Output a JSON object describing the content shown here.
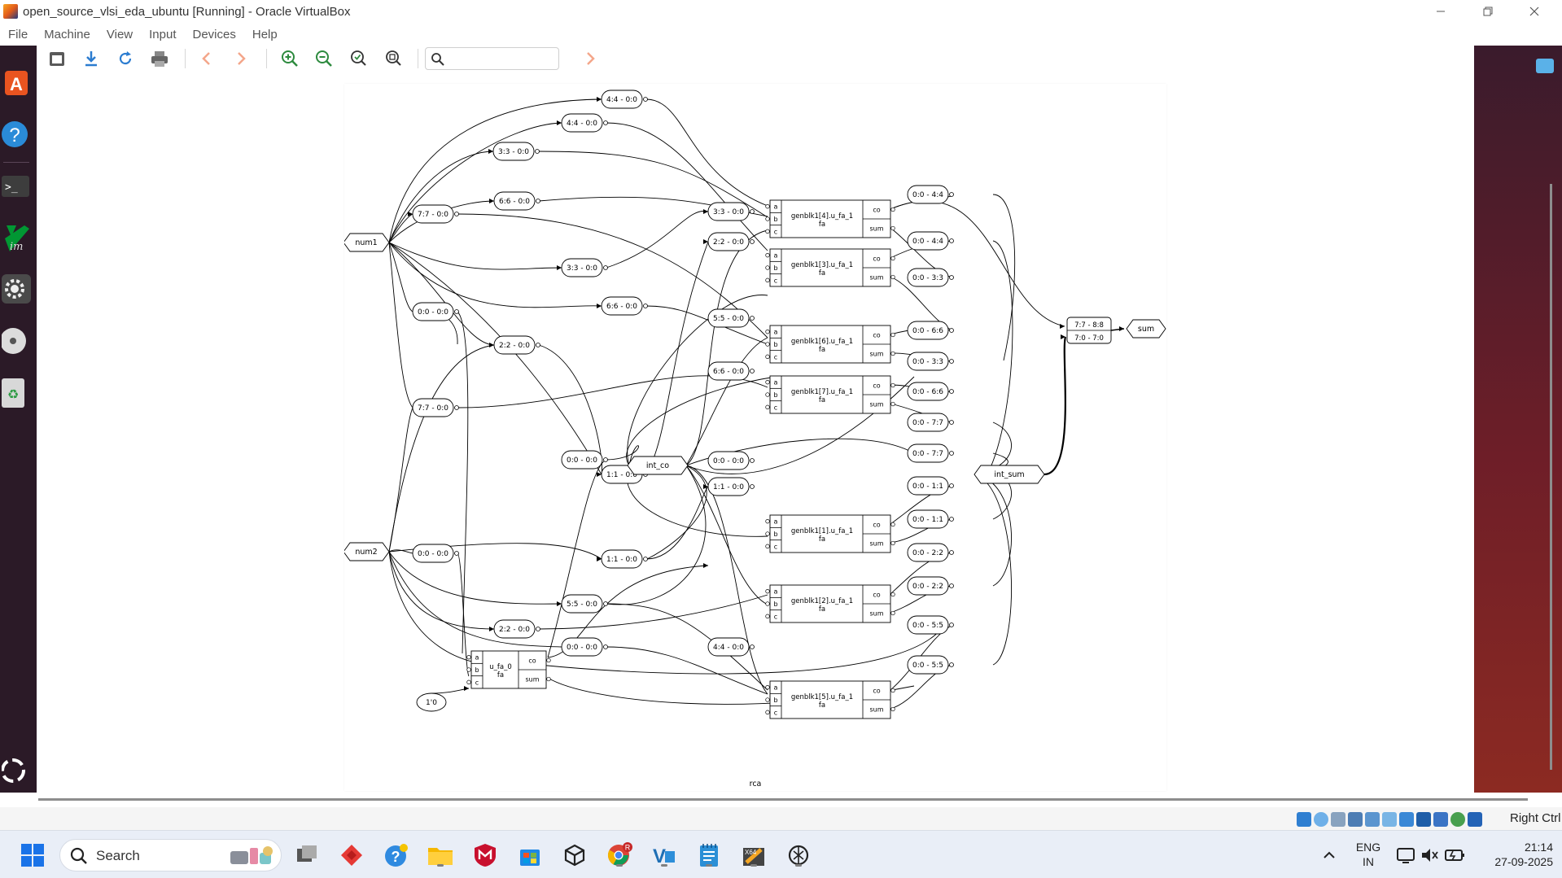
{
  "window": {
    "title": "open_source_vlsi_eda_ubuntu [Running] - Oracle VirtualBox",
    "minimize_icon": "minimize-icon",
    "maximize_icon": "restore-icon",
    "close_icon": "close-icon"
  },
  "menu": {
    "items": [
      "File",
      "Machine",
      "View",
      "Input",
      "Devices",
      "Help"
    ]
  },
  "viewer": {
    "search_value": ""
  },
  "graph": {
    "module_label": "rca",
    "ports": [
      "num1",
      "num2",
      "int_co",
      "int_sum",
      "sum"
    ],
    "cells": [
      {
        "name": "genblk1[4].u_fa_1",
        "type": "fa"
      },
      {
        "name": "genblk1[3].u_fa_1",
        "type": "fa"
      },
      {
        "name": "genblk1[6].u_fa_1",
        "type": "fa"
      },
      {
        "name": "genblk1[7].u_fa_1",
        "type": "fa"
      },
      {
        "name": "genblk1[1].u_fa_1",
        "type": "fa"
      },
      {
        "name": "genblk1[2].u_fa_1",
        "type": "fa"
      },
      {
        "name": "genblk1[5].u_fa_1",
        "type": "fa"
      },
      {
        "name": "u_fa_0",
        "type": "fa"
      }
    ],
    "pin_labels": {
      "a": "a",
      "b": "b",
      "c": "c",
      "co": "co",
      "sum": "sum"
    },
    "const": "1'0",
    "sum_concat": [
      "7:7 - 8:8",
      "7:0 - 7:0"
    ],
    "slices": {
      "s44_top": "4:4 - 0:0",
      "s44_b": "4:4 - 0:0",
      "s33_a": "3:3 - 0:0",
      "s66_a": "6:6 - 0:0",
      "s77_a": "7:7 - 0:0",
      "s33_b": "3:3 - 0:0",
      "s00_a": "0:0 - 0:0",
      "s66_b": "6:6 - 0:0",
      "s22_a": "2:2 - 0:0",
      "s77_b": "7:7 - 0:0",
      "s00_b": "0:0 - 0:0",
      "s11_a": "1:1 - 0:0",
      "s11_b": "1:1 - 0:0",
      "s00_c": "0:0 - 0:0",
      "s55_a": "5:5 - 0:0",
      "s22_b": "2:2 - 0:0",
      "s00_d": "0:0 - 0:0",
      "s55_b": "5:5 - 0:0",
      "c33": "3:3 - 0:0",
      "c22": "2:2 - 0:0",
      "c55": "5:5 - 0:0",
      "c66": "6:6 - 0:0",
      "c00": "0:0 - 0:0",
      "c11": "1:1 - 0:0",
      "c44": "4:4 - 0:0",
      "o44a": "0:0 - 4:4",
      "o44b": "0:0 - 4:4",
      "o33a": "0:0 - 3:3",
      "o66a": "0:0 - 6:6",
      "o33b": "0:0 - 3:3",
      "o66b": "0:0 - 6:6",
      "o77a": "0:0 - 7:7",
      "o77b": "0:0 - 7:7",
      "o11a": "0:0 - 1:1",
      "o11b": "0:0 - 1:1",
      "o22a": "0:0 - 2:2",
      "o22b": "0:0 - 2:2",
      "o55a": "0:0 - 5:5",
      "o55b": "0:0 - 5:5"
    }
  },
  "statusbar": {
    "host_key": "Right Ctrl"
  },
  "taskbar": {
    "search_label": "Search",
    "lang_line1": "ENG",
    "lang_line2": "IN",
    "time": "21:14",
    "date": "27-09-2025",
    "chrome_badge": "R"
  }
}
